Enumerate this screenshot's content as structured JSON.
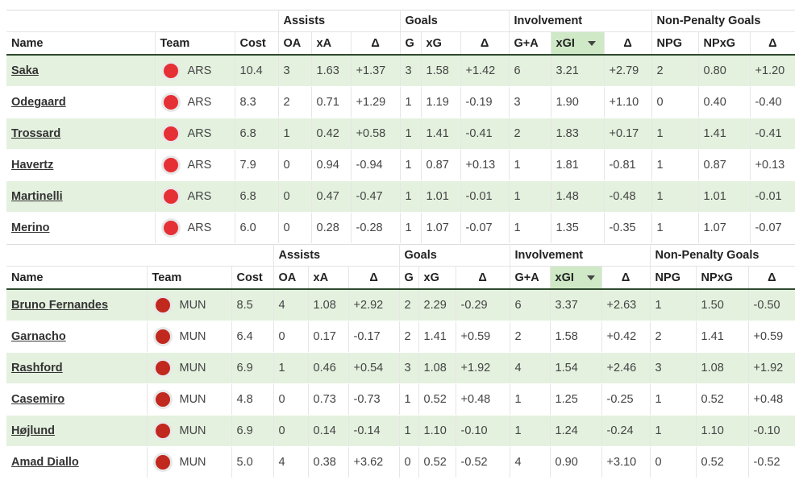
{
  "colors": {
    "ars_badge": "#e53036",
    "mun_badge": "#c1281e",
    "row_highlight": "#e4f1df",
    "sorted_col": "#cfe9c7"
  },
  "tables": [
    {
      "team": "ARS",
      "groups": {
        "assists": "Assists",
        "goals": "Goals",
        "involvement": "Involvement",
        "npg": "Non-Penalty Goals"
      },
      "headers": {
        "name": "Name",
        "team": "Team",
        "cost": "Cost",
        "oa": "OA",
        "xa": "xA",
        "d_assists": "Δ",
        "g": "G",
        "xg": "xG",
        "d_goals": "Δ",
        "ga": "G+A",
        "xgi": "xGI",
        "d_inv": "Δ",
        "npg": "NPG",
        "npxg": "NPxG",
        "d_npg": "Δ"
      },
      "rows": [
        {
          "name": "Saka",
          "team": "ARS",
          "cost": "10.4",
          "oa": "3",
          "xa": "1.63",
          "d_assists": "+1.37",
          "g": "3",
          "xg": "1.58",
          "d_goals": "+1.42",
          "ga": "6",
          "xgi": "3.21",
          "d_inv": "+2.79",
          "npg": "2",
          "npxg": "0.80",
          "d_npg": "+1.20"
        },
        {
          "name": "Odegaard",
          "team": "ARS",
          "cost": "8.3",
          "oa": "2",
          "xa": "0.71",
          "d_assists": "+1.29",
          "g": "1",
          "xg": "1.19",
          "d_goals": "-0.19",
          "ga": "3",
          "xgi": "1.90",
          "d_inv": "+1.10",
          "npg": "0",
          "npxg": "0.40",
          "d_npg": "-0.40"
        },
        {
          "name": "Trossard",
          "team": "ARS",
          "cost": "6.8",
          "oa": "1",
          "xa": "0.42",
          "d_assists": "+0.58",
          "g": "1",
          "xg": "1.41",
          "d_goals": "-0.41",
          "ga": "2",
          "xgi": "1.83",
          "d_inv": "+0.17",
          "npg": "1",
          "npxg": "1.41",
          "d_npg": "-0.41"
        },
        {
          "name": "Havertz",
          "team": "ARS",
          "cost": "7.9",
          "oa": "0",
          "xa": "0.94",
          "d_assists": "-0.94",
          "g": "1",
          "xg": "0.87",
          "d_goals": "+0.13",
          "ga": "1",
          "xgi": "1.81",
          "d_inv": "-0.81",
          "npg": "1",
          "npxg": "0.87",
          "d_npg": "+0.13"
        },
        {
          "name": "Martinelli",
          "team": "ARS",
          "cost": "6.8",
          "oa": "0",
          "xa": "0.47",
          "d_assists": "-0.47",
          "g": "1",
          "xg": "1.01",
          "d_goals": "-0.01",
          "ga": "1",
          "xgi": "1.48",
          "d_inv": "-0.48",
          "npg": "1",
          "npxg": "1.01",
          "d_npg": "-0.01"
        },
        {
          "name": "Merino",
          "team": "ARS",
          "cost": "6.0",
          "oa": "0",
          "xa": "0.28",
          "d_assists": "-0.28",
          "g": "1",
          "xg": "1.07",
          "d_goals": "-0.07",
          "ga": "1",
          "xgi": "1.35",
          "d_inv": "-0.35",
          "npg": "1",
          "npxg": "1.07",
          "d_npg": "-0.07"
        }
      ]
    },
    {
      "team": "MUN",
      "groups": {
        "assists": "Assists",
        "goals": "Goals",
        "involvement": "Involvement",
        "npg": "Non-Penalty Goals"
      },
      "headers": {
        "name": "Name",
        "team": "Team",
        "cost": "Cost",
        "oa": "OA",
        "xa": "xA",
        "d_assists": "Δ",
        "g": "G",
        "xg": "xG",
        "d_goals": "Δ",
        "ga": "G+A",
        "xgi": "xGI",
        "d_inv": "Δ",
        "npg": "NPG",
        "npxg": "NPxG",
        "d_npg": "Δ"
      },
      "rows": [
        {
          "name": "Bruno Fernandes",
          "team": "MUN",
          "cost": "8.5",
          "oa": "4",
          "xa": "1.08",
          "d_assists": "+2.92",
          "g": "2",
          "xg": "2.29",
          "d_goals": "-0.29",
          "ga": "6",
          "xgi": "3.37",
          "d_inv": "+2.63",
          "npg": "1",
          "npxg": "1.50",
          "d_npg": "-0.50"
        },
        {
          "name": "Garnacho",
          "team": "MUN",
          "cost": "6.4",
          "oa": "0",
          "xa": "0.17",
          "d_assists": "-0.17",
          "g": "2",
          "xg": "1.41",
          "d_goals": "+0.59",
          "ga": "2",
          "xgi": "1.58",
          "d_inv": "+0.42",
          "npg": "2",
          "npxg": "1.41",
          "d_npg": "+0.59"
        },
        {
          "name": "Rashford",
          "team": "MUN",
          "cost": "6.9",
          "oa": "1",
          "xa": "0.46",
          "d_assists": "+0.54",
          "g": "3",
          "xg": "1.08",
          "d_goals": "+1.92",
          "ga": "4",
          "xgi": "1.54",
          "d_inv": "+2.46",
          "npg": "3",
          "npxg": "1.08",
          "d_npg": "+1.92"
        },
        {
          "name": "Casemiro",
          "team": "MUN",
          "cost": "4.8",
          "oa": "0",
          "xa": "0.73",
          "d_assists": "-0.73",
          "g": "1",
          "xg": "0.52",
          "d_goals": "+0.48",
          "ga": "1",
          "xgi": "1.25",
          "d_inv": "-0.25",
          "npg": "1",
          "npxg": "0.52",
          "d_npg": "+0.48"
        },
        {
          "name": "Højlund",
          "team": "MUN",
          "cost": "6.9",
          "oa": "0",
          "xa": "0.14",
          "d_assists": "-0.14",
          "g": "1",
          "xg": "1.10",
          "d_goals": "-0.10",
          "ga": "1",
          "xgi": "1.24",
          "d_inv": "-0.24",
          "npg": "1",
          "npxg": "1.10",
          "d_npg": "-0.10"
        },
        {
          "name": "Amad Diallo",
          "team": "MUN",
          "cost": "5.0",
          "oa": "4",
          "xa": "0.38",
          "d_assists": "+3.62",
          "g": "0",
          "xg": "0.52",
          "d_goals": "-0.52",
          "ga": "4",
          "xgi": "0.90",
          "d_inv": "+3.10",
          "npg": "0",
          "npxg": "0.52",
          "d_npg": "-0.52"
        }
      ]
    }
  ]
}
